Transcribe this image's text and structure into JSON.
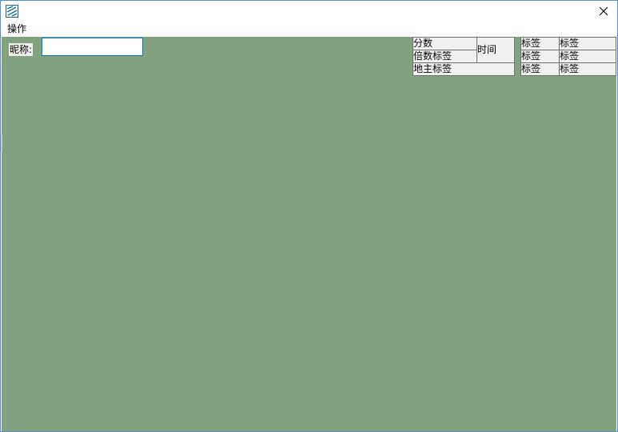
{
  "window": {
    "title": ""
  },
  "menu": {
    "items": [
      {
        "label": "操作"
      }
    ]
  },
  "form": {
    "nickname_label": "昵称:",
    "nickname_value": ""
  },
  "info_panel": {
    "score": "分数",
    "time": "时间",
    "multiplier": "倍数标签",
    "landlord": "地主标签",
    "labels": [
      "标签",
      "标签",
      "标签",
      "标签",
      "标签",
      "标签"
    ]
  },
  "colors": {
    "client_background": "#81a17f",
    "window_border": "#5b8ec9",
    "input_focus": "#0078d7"
  },
  "icons": {
    "app": "app-icon",
    "close": "close-icon"
  }
}
